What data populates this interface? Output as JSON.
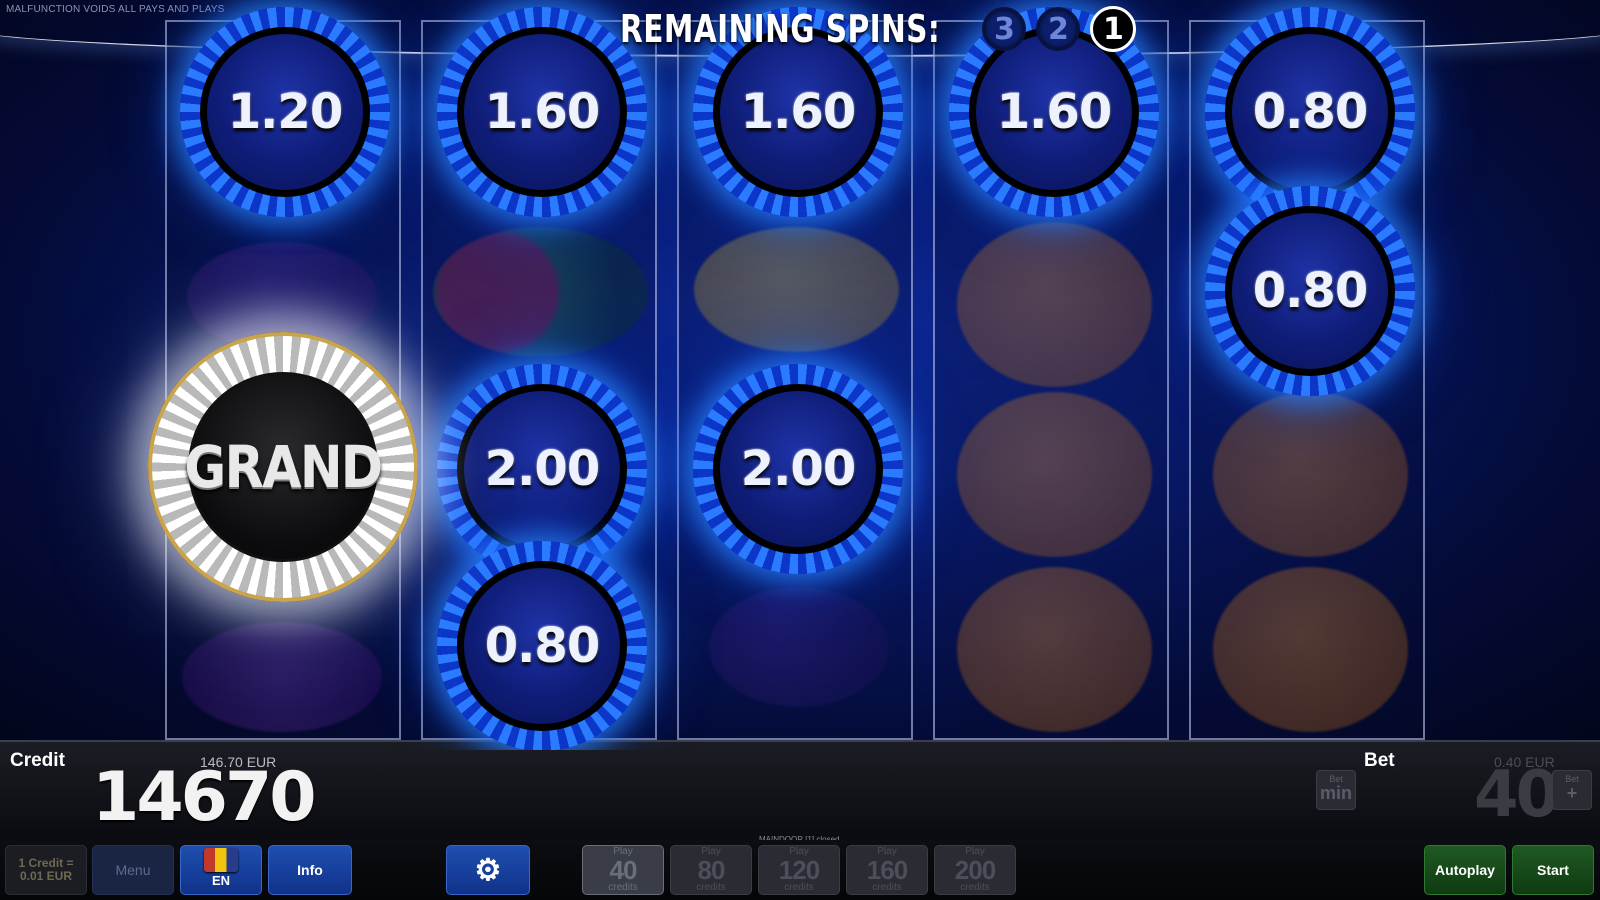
{
  "notice": "MALFUNCTION VOIDS ALL PAYS AND PLAYS",
  "remaining_spins": {
    "label": "REMAINING SPINS:",
    "counters": [
      {
        "value": "3",
        "active": false
      },
      {
        "value": "2",
        "active": false
      },
      {
        "value": "1",
        "active": true
      }
    ]
  },
  "coins": {
    "r1_top": "1.20",
    "r1_grand": "GRAND",
    "r2_top": "1.60",
    "r2_mid": "2.00",
    "r2_bot": "0.80",
    "r3_top": "1.60",
    "r3_mid": "2.00",
    "r4_top": "1.60",
    "r5_top": "0.80",
    "r5_second": "0.80"
  },
  "background_symbols": {
    "reel1": [
      "plum",
      "grapes"
    ],
    "reel2": [
      "watermelon"
    ],
    "reel3": [
      "lemon",
      "plum"
    ],
    "reel4": [
      "orange",
      "orange",
      "orange"
    ],
    "reel5": [
      "orange",
      "orange"
    ]
  },
  "credit": {
    "label": "Credit",
    "eur": "146.70 EUR",
    "value": "14670"
  },
  "bet": {
    "label": "Bet",
    "eur": "0.40 EUR",
    "value": "40",
    "min_small": "Bet",
    "min_big": "min",
    "plus_small": "Bet",
    "plus_big": "+"
  },
  "toolbar": {
    "denomination_line1": "1 Credit =",
    "denomination_line2": "0.01 EUR",
    "menu": "Menu",
    "language": "EN",
    "info": "Info",
    "settings_icon": "gear-icon",
    "play_options": [
      {
        "top": "Play",
        "value": "40",
        "bottom": "credits",
        "selected": true
      },
      {
        "top": "Play",
        "value": "80",
        "bottom": "credits",
        "selected": false
      },
      {
        "top": "Play",
        "value": "120",
        "bottom": "credits",
        "selected": false
      },
      {
        "top": "Play",
        "value": "160",
        "bottom": "credits",
        "selected": false
      },
      {
        "top": "Play",
        "value": "200",
        "bottom": "credits",
        "selected": false
      }
    ],
    "autoplay": "Autoplay",
    "start": "Start"
  },
  "status_message": "MAINDOOR [1] closed.",
  "colors": {
    "coin_blue": "#2a7bff",
    "grand_silver": "#ffffff",
    "start_green": "#1f5a22",
    "accent_blue": "#1e4fb0"
  }
}
